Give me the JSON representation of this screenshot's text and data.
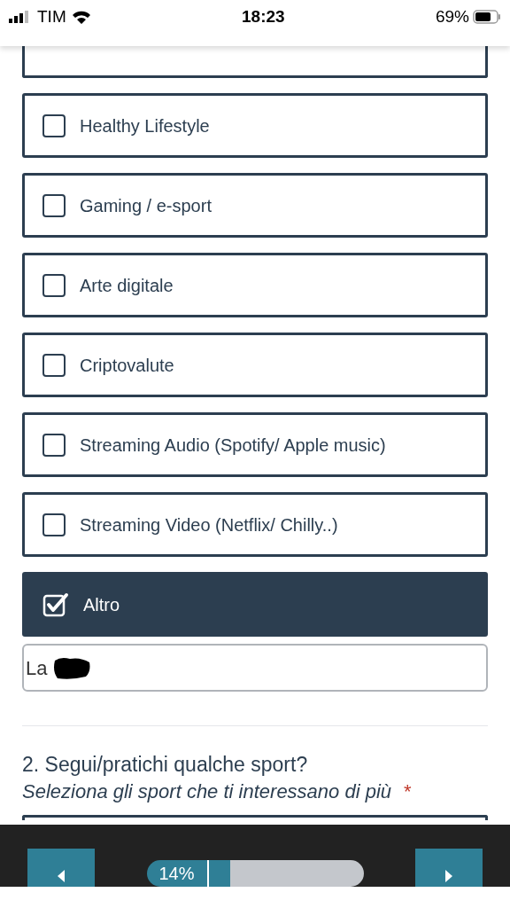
{
  "status_bar": {
    "carrier": "TIM",
    "time": "18:23",
    "battery": "69%"
  },
  "options": [
    {
      "label": "Healthy Lifestyle",
      "checked": false
    },
    {
      "label": "Gaming / e-sport",
      "checked": false
    },
    {
      "label": "Arte digitale",
      "checked": false
    },
    {
      "label": "Criptovalute",
      "checked": false
    },
    {
      "label": "Streaming Audio (Spotify/ Apple music)",
      "checked": false
    },
    {
      "label": "Streaming Video (Netflix/ Chilly..)",
      "checked": false
    },
    {
      "label": "Altro",
      "checked": true
    }
  ],
  "other_field": {
    "value": "La"
  },
  "question": {
    "title": "2. Segui/pratichi qualche sport?",
    "subtitle": "Seleziona gli sport che ti interessano di più",
    "required_mark": "*"
  },
  "footer": {
    "progress": {
      "label": "14%",
      "level": 0.14
    }
  }
}
